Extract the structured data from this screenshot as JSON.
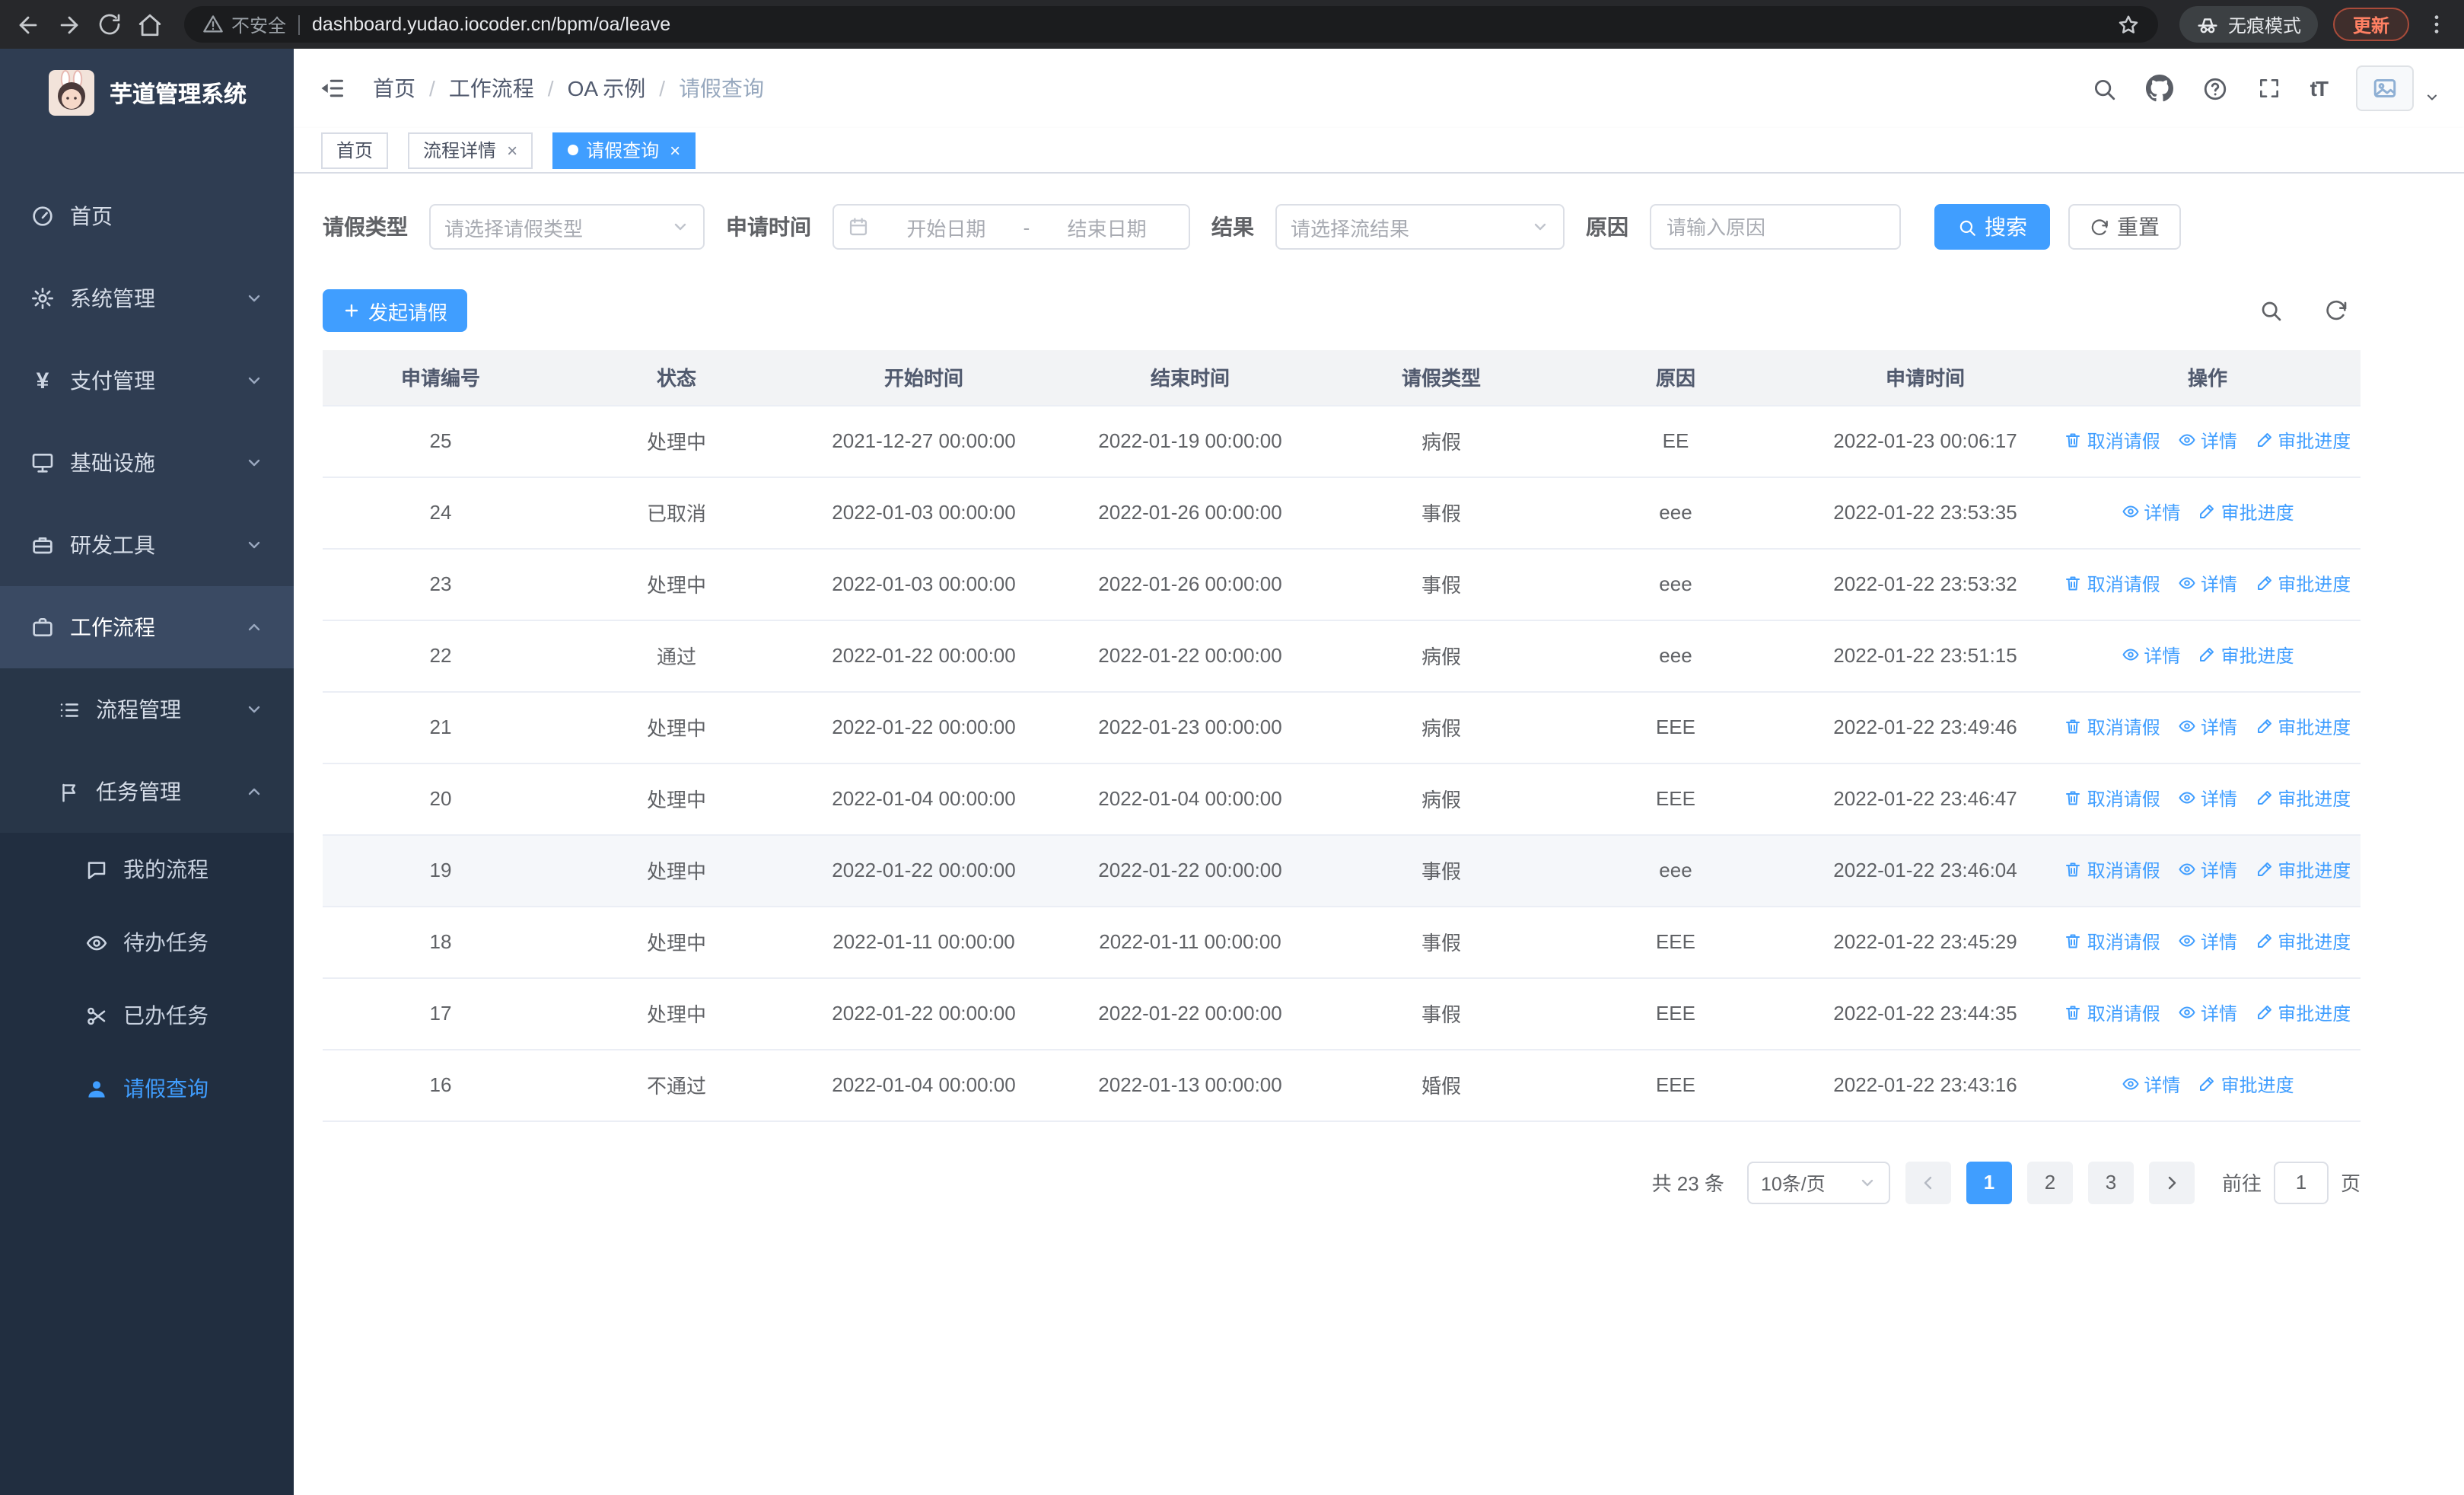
{
  "theme": {
    "primary": "#409eff",
    "sidebar_bg": "#2f3d52",
    "submenu_bg": "#212e40"
  },
  "browser": {
    "security_warning": "不安全",
    "url": "dashboard.yudao.iocoder.cn/bpm/oa/leave",
    "incognito_label": "无痕模式",
    "update_label": "更新"
  },
  "sidebar": {
    "app_title": "芋道管理系统",
    "items": [
      {
        "label": "首页"
      },
      {
        "label": "系统管理"
      },
      {
        "label": "支付管理"
      },
      {
        "label": "基础设施"
      },
      {
        "label": "研发工具"
      },
      {
        "label": "工作流程"
      },
      {
        "label": "流程管理"
      },
      {
        "label": "任务管理"
      },
      {
        "label": "我的流程"
      },
      {
        "label": "待办任务"
      },
      {
        "label": "已办任务"
      },
      {
        "label": "请假查询"
      }
    ]
  },
  "topbar": {
    "breadcrumb": [
      "首页",
      "工作流程",
      "OA 示例",
      "请假查询"
    ],
    "font_size_icon_label": "tT"
  },
  "tabs": [
    {
      "label": "首页"
    },
    {
      "label": "流程详情"
    },
    {
      "label": "请假查询"
    }
  ],
  "filters": {
    "leave_type_label": "请假类型",
    "leave_type_placeholder": "请选择请假类型",
    "apply_time_label": "申请时间",
    "start_date_placeholder": "开始日期",
    "range_separator": "-",
    "end_date_placeholder": "结束日期",
    "result_label": "结果",
    "result_placeholder": "请选择流结果",
    "reason_label": "原因",
    "reason_placeholder": "请输入原因",
    "search_label": "搜索",
    "reset_label": "重置"
  },
  "toolbar": {
    "create_label": "发起请假"
  },
  "table": {
    "headers": [
      "申请编号",
      "状态",
      "开始时间",
      "结束时间",
      "请假类型",
      "原因",
      "申请时间",
      "操作"
    ],
    "action_labels": {
      "cancel": "取消请假",
      "detail": "详情",
      "progress": "审批进度"
    },
    "rows": [
      {
        "id": "25",
        "status": "处理中",
        "start": "2021-12-27 00:00:00",
        "end": "2022-01-19 00:00:00",
        "type": "病假",
        "reason": "EE",
        "applied": "2022-01-23 00:06:17"
      },
      {
        "id": "24",
        "status": "已取消",
        "start": "2022-01-03 00:00:00",
        "end": "2022-01-26 00:00:00",
        "type": "事假",
        "reason": "eee",
        "applied": "2022-01-22 23:53:35"
      },
      {
        "id": "23",
        "status": "处理中",
        "start": "2022-01-03 00:00:00",
        "end": "2022-01-26 00:00:00",
        "type": "事假",
        "reason": "eee",
        "applied": "2022-01-22 23:53:32"
      },
      {
        "id": "22",
        "status": "通过",
        "start": "2022-01-22 00:00:00",
        "end": "2022-01-22 00:00:00",
        "type": "病假",
        "reason": "eee",
        "applied": "2022-01-22 23:51:15"
      },
      {
        "id": "21",
        "status": "处理中",
        "start": "2022-01-22 00:00:00",
        "end": "2022-01-23 00:00:00",
        "type": "病假",
        "reason": "EEE",
        "applied": "2022-01-22 23:49:46"
      },
      {
        "id": "20",
        "status": "处理中",
        "start": "2022-01-04 00:00:00",
        "end": "2022-01-04 00:00:00",
        "type": "病假",
        "reason": "EEE",
        "applied": "2022-01-22 23:46:47"
      },
      {
        "id": "19",
        "status": "处理中",
        "start": "2022-01-22 00:00:00",
        "end": "2022-01-22 00:00:00",
        "type": "事假",
        "reason": "eee",
        "applied": "2022-01-22 23:46:04"
      },
      {
        "id": "18",
        "status": "处理中",
        "start": "2022-01-11 00:00:00",
        "end": "2022-01-11 00:00:00",
        "type": "事假",
        "reason": "EEE",
        "applied": "2022-01-22 23:45:29"
      },
      {
        "id": "17",
        "status": "处理中",
        "start": "2022-01-22 00:00:00",
        "end": "2022-01-22 00:00:00",
        "type": "事假",
        "reason": "EEE",
        "applied": "2022-01-22 23:44:35"
      },
      {
        "id": "16",
        "status": "不通过",
        "start": "2022-01-04 00:00:00",
        "end": "2022-01-13 00:00:00",
        "type": "婚假",
        "reason": "EEE",
        "applied": "2022-01-22 23:43:16"
      }
    ]
  },
  "pagination": {
    "total_text": "共 23 条",
    "page_size_label": "10条/页",
    "pages": [
      "1",
      "2",
      "3"
    ],
    "goto_label": "前往",
    "goto_value": "1",
    "goto_suffix": "页"
  }
}
